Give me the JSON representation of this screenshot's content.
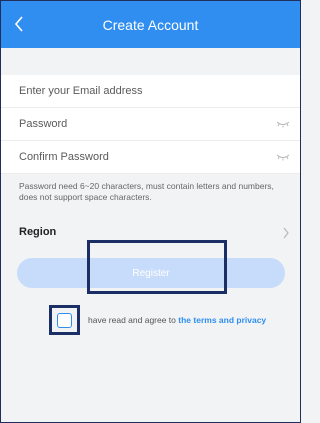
{
  "header": {
    "title": "Create Account",
    "back_icon": "chevron-left-icon"
  },
  "form": {
    "email_label": "Enter your Email address",
    "password_label": "Password",
    "confirm_label": "Confirm Password",
    "eye_icon": "eye-closed-icon",
    "hint": "Password need 6~20 characters, must contain letters and numbers, does not support space characters."
  },
  "region": {
    "label": "Region",
    "icon": "chevron-right-icon"
  },
  "register": {
    "label": "Register"
  },
  "agreement": {
    "text": "have read and agree to",
    "link": "the terms and privacy",
    "checked": false
  },
  "colors": {
    "accent": "#2f8ef0",
    "register_disabled": "#c7dcfa",
    "highlight_box": "#1c2e66"
  }
}
